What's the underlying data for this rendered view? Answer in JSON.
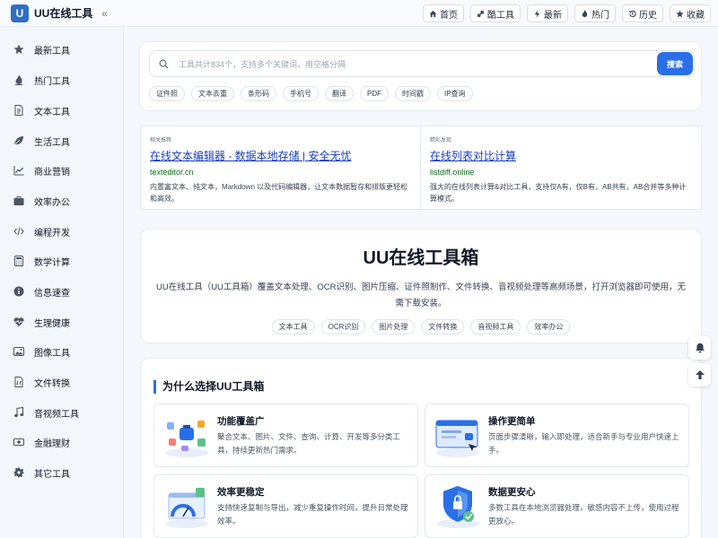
{
  "header": {
    "logo_letter": "U",
    "title": "UU在线工具",
    "collapse": "«",
    "nav": [
      {
        "label": "首页",
        "icon": "home-icon"
      },
      {
        "label": "酷工具",
        "icon": "link-icon"
      },
      {
        "label": "最新",
        "icon": "bolt-icon"
      },
      {
        "label": "热门",
        "icon": "fire-icon"
      },
      {
        "label": "历史",
        "icon": "history-icon"
      },
      {
        "label": "收藏",
        "icon": "star-icon"
      }
    ]
  },
  "sidebar": {
    "items": [
      {
        "label": "最新工具",
        "icon": "star-icon"
      },
      {
        "label": "热门工具",
        "icon": "fire-icon"
      },
      {
        "label": "文本工具",
        "icon": "document-icon"
      },
      {
        "label": "生活工具",
        "icon": "leaf-icon"
      },
      {
        "label": "商业营销",
        "icon": "chart-line-icon"
      },
      {
        "label": "效率办公",
        "icon": "briefcase-icon"
      },
      {
        "label": "编程开发",
        "icon": "code-icon"
      },
      {
        "label": "数学计算",
        "icon": "calculator-icon"
      },
      {
        "label": "信息速查",
        "icon": "info-icon"
      },
      {
        "label": "生理健康",
        "icon": "heart-pulse-icon"
      },
      {
        "label": "图像工具",
        "icon": "image-icon"
      },
      {
        "label": "文件转换",
        "icon": "file-convert-icon"
      },
      {
        "label": "音视频工具",
        "icon": "music-icon"
      },
      {
        "label": "金融理财",
        "icon": "money-icon"
      },
      {
        "label": "其它工具",
        "icon": "gear-icon"
      }
    ]
  },
  "search": {
    "placeholder": "工具共计834个，支持多个关键词，用空格分隔",
    "button": "搜索",
    "chips": [
      "证件照",
      "文本去重",
      "条形码",
      "手机号",
      "翻译",
      "PDF",
      "时间戳",
      "IP查询"
    ]
  },
  "ads": [
    {
      "label": "相关推荐",
      "title": "在线文本编辑器 - 数据本地存储 | 安全无忧",
      "url": "texteditor.cn",
      "desc": "内置富文本、纯文本，Markdown 以及代码编辑器，让文本数据暂存和排版更轻松和高效。"
    },
    {
      "label": "精彩发现",
      "title": "在线列表对比计算",
      "url": "listdiff.online",
      "desc": "强大的在线列表计算&对比工具，支持仅A有，仅B有，AB共有，AB合并等多种计算模式。"
    }
  ],
  "hero": {
    "title": "UU在线工具箱",
    "desc": "UU在线工具（UU工具箱）覆盖文本处理、OCR识别、图片压缩、证件照制作、文件转换、音视频处理等高频场景，打开浏览器即可使用，无需下载安装。",
    "tags": [
      "文本工具",
      "OCR识别",
      "图片处理",
      "文件转换",
      "音视频工具",
      "效率办公"
    ]
  },
  "why": {
    "title": "为什么选择UU工具箱",
    "features": [
      {
        "title": "功能覆盖广",
        "desc": "聚合文本、图片、文件、查询、计算、开发等多分类工具，持续更新热门需求。",
        "icon": "apps-illustration"
      },
      {
        "title": "操作更简单",
        "desc": "页面步骤清晰，输入即处理，适合新手与专业用户快速上手。",
        "icon": "browser-illustration"
      },
      {
        "title": "效率更稳定",
        "desc": "支持快速复制与导出，减少重复操作时间，提升日常处理效率。",
        "icon": "speed-illustration"
      },
      {
        "title": "数据更安心",
        "desc": "多数工具在本地浏览器处理，敏感内容不上传，使用过程更放心。",
        "icon": "shield-illustration"
      }
    ]
  },
  "floating": [
    "bell-icon",
    "arrow-up-icon"
  ],
  "colors": {
    "accent": "#2b6fe8",
    "link": "#1a3dbf",
    "url": "#116b1e",
    "logo": "#2d6fc4"
  }
}
